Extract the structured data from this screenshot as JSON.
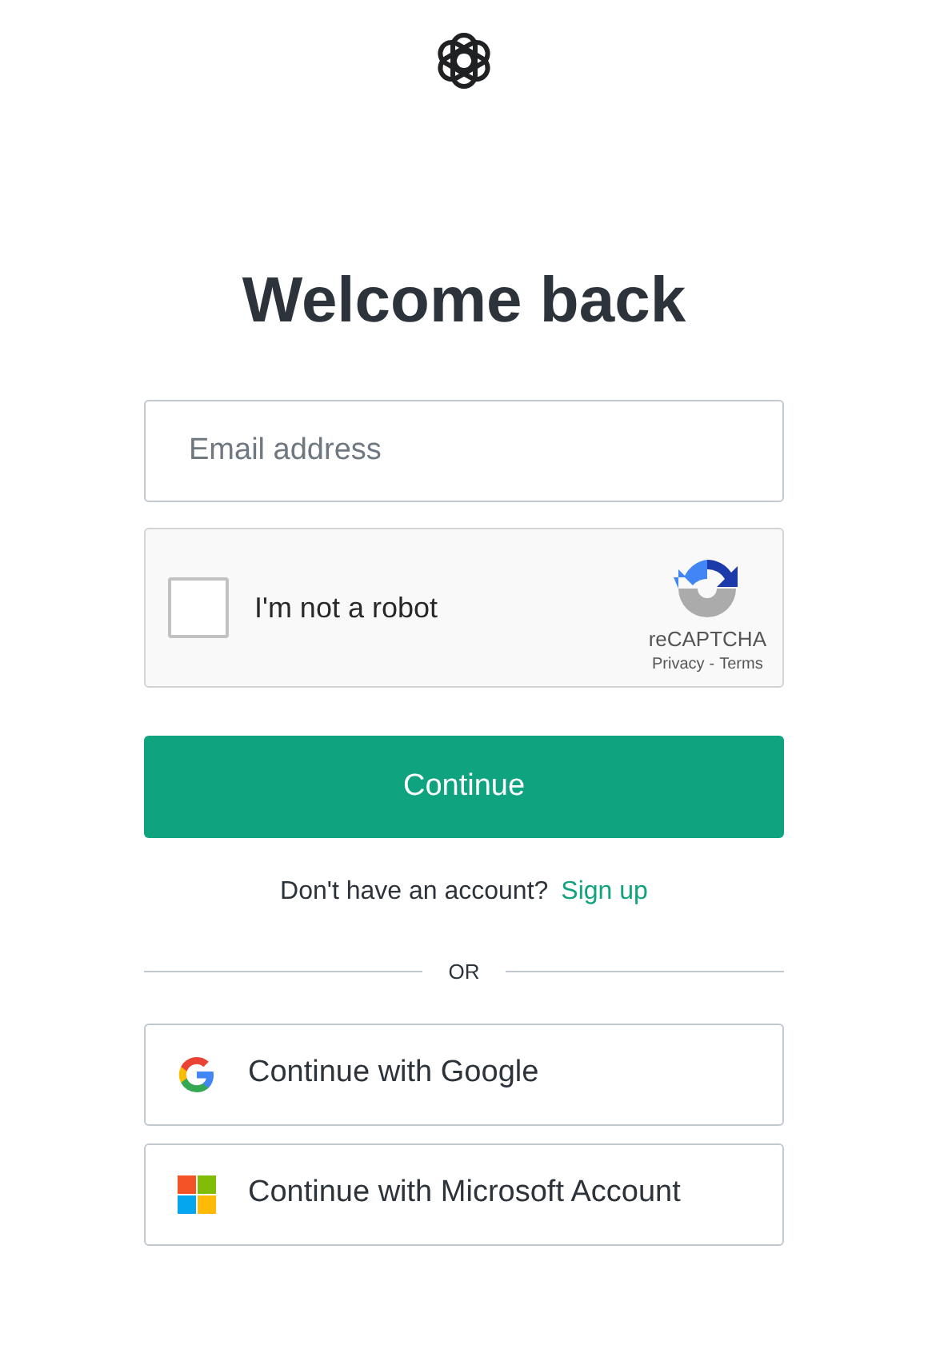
{
  "title": "Welcome back",
  "email": {
    "placeholder": "Email address"
  },
  "captcha": {
    "label": "I'm not a robot",
    "checked": false,
    "brand": "reCAPTCHA",
    "privacy": "Privacy",
    "separator": "-",
    "terms": "Terms"
  },
  "continue_button": "Continue",
  "signup": {
    "prompt": "Don't have an account?",
    "link": "Sign up"
  },
  "divider": "OR",
  "social_buttons": [
    {
      "kind": "google",
      "label": "Continue with Google"
    },
    {
      "kind": "microsoft",
      "label": "Continue with Microsoft Account"
    }
  ]
}
